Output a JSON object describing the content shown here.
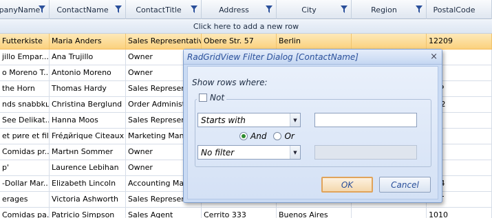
{
  "grid": {
    "columns": [
      "panyName",
      "ContactName",
      "ContactTitle",
      "Address",
      "City",
      "Region",
      "PostalCode"
    ],
    "add_new_row": "Click here to add a new row",
    "rows": [
      [
        "Futterkiste",
        "Maria Anders",
        "Sales Representative",
        "Obere Str. 57",
        "Berlin",
        "",
        "12209"
      ],
      [
        "jillo Empar...",
        "Ana Trujillo",
        "Owner",
        "",
        "",
        "",
        "21"
      ],
      [
        "o Moreno T...",
        "Antonio Moreno",
        "Owner",
        "",
        "",
        "",
        "23"
      ],
      [
        "the Horn",
        "Thomas Hardy",
        "Sales Representa",
        "",
        "",
        "",
        "1DP"
      ],
      [
        "nds snabbkцp",
        "Christina Berglund",
        "Order Administra",
        "",
        "",
        "",
        "8 22"
      ],
      [
        "See Delikat...",
        "Hanna Moos",
        "Sales Representa",
        "",
        "",
        "",
        "06"
      ],
      [
        "et pиre et fils",
        "Fréдйrique Citeaux",
        "Marketing Mana",
        "",
        "",
        "",
        "00"
      ],
      [
        "Comidas pr...",
        "Martнn Sommer",
        "Owner",
        "",
        "",
        "",
        "23"
      ],
      [
        "p'",
        "Laurence Lebihan",
        "Owner",
        "",
        "",
        "",
        "08"
      ],
      [
        "-Dollar Mar...",
        "Elizabeth Lincoln",
        "Accounting Mana",
        "",
        "",
        "",
        "8M4"
      ],
      [
        "erages",
        "Victoria Ashworth",
        "Sales Representa",
        "",
        "",
        "",
        "5NT"
      ],
      [
        "Comidas pa...",
        "Patricio Simpson",
        "Sales Agent",
        "Cerrito 333",
        "Buenos Aires",
        "",
        "1010"
      ]
    ]
  },
  "dialog": {
    "title": "RadGridView Filter Dialog [ContactName]",
    "close_glyph": "×",
    "show_rows_label": "Show rows where:",
    "not_label": "Not",
    "not_checked": false,
    "operator1": "Starts with",
    "value1": "",
    "and_label": "And",
    "or_label": "Or",
    "logic_selected": "And",
    "operator2": "No filter",
    "value2": "",
    "ok_label": "OK",
    "cancel_label": "Cancel"
  },
  "icons": {
    "header_filter": "funnel-icon",
    "dropdown": "triangle-down-icon"
  },
  "colors": {
    "selected_row": "#fbd17d",
    "dialog_bg": "#c9daf3",
    "dialog_title_text": "#2a4f9a",
    "radio_selected": "#2e8b2e",
    "ok_border": "#e0a35a"
  }
}
